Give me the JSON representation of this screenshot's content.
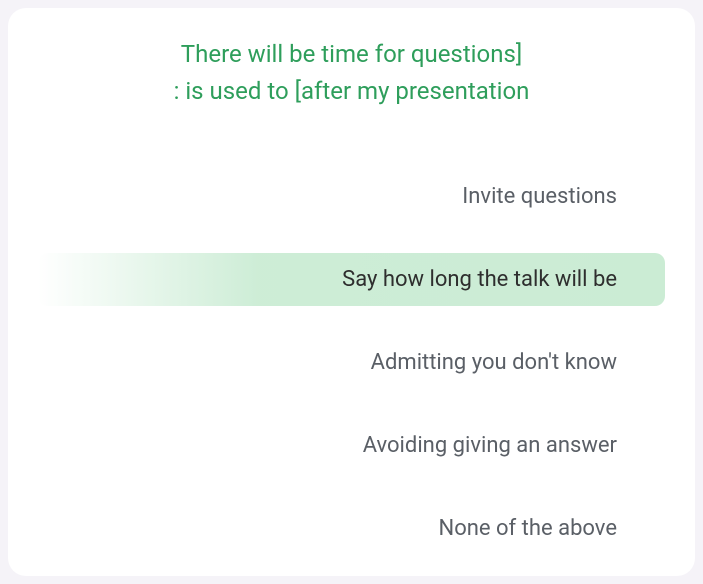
{
  "question": {
    "line1": "There will be time for questions]",
    "line2": ": is used to [after my presentation"
  },
  "options": [
    {
      "label": "Invite questions",
      "selected": false
    },
    {
      "label": "Say how long the talk will be",
      "selected": true
    },
    {
      "label": "Admitting you don't know",
      "selected": false
    },
    {
      "label": "Avoiding giving an answer",
      "selected": false
    },
    {
      "label": "None of the above",
      "selected": false
    }
  ]
}
